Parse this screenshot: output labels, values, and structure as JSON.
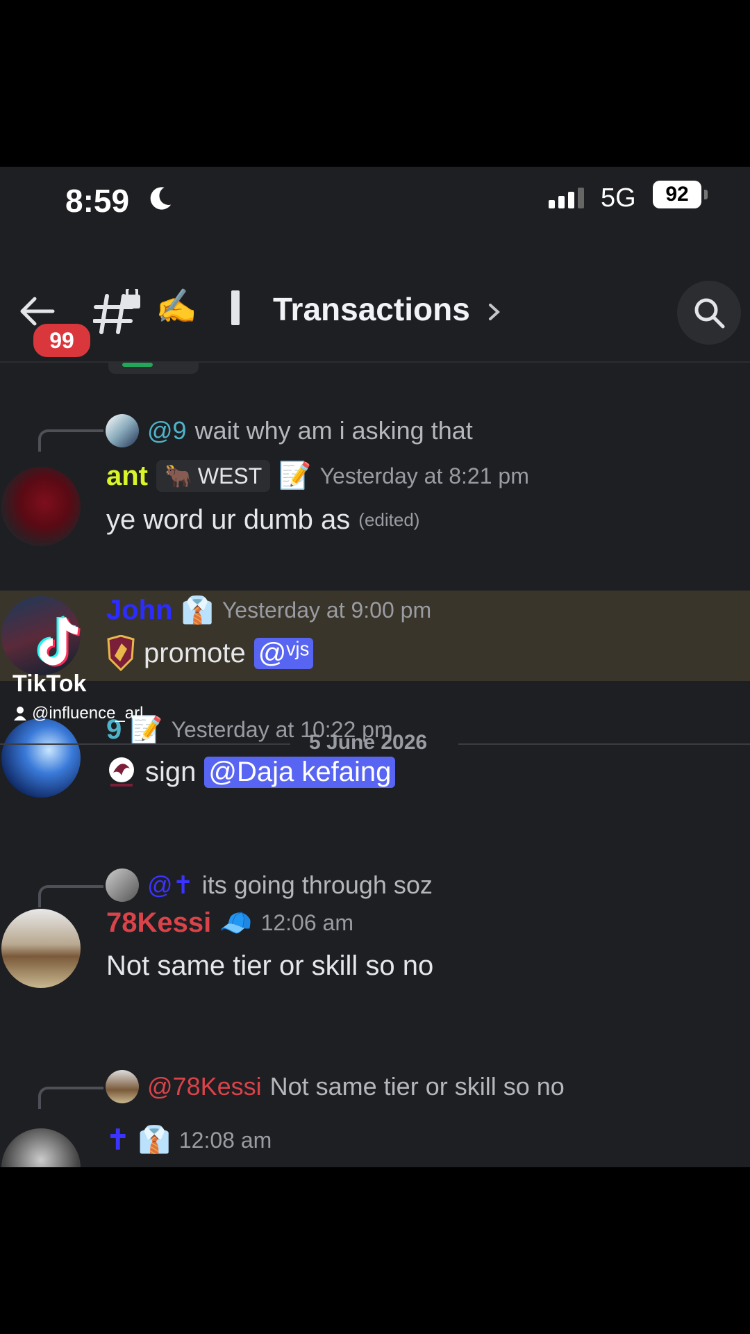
{
  "status_bar": {
    "time": "8:59",
    "network": "5G",
    "battery": "92"
  },
  "header": {
    "unread_count": "99",
    "channel_name": "Transactions"
  },
  "messages": [
    {
      "reply_to": {
        "author": "@9",
        "text": "wait why am i asking that"
      },
      "author": "ant",
      "role": "WEST",
      "timestamp": "Yesterday at 8:21 pm",
      "text": "ye word ur dumb as",
      "edited": "(edited)"
    },
    {
      "author": "John",
      "timestamp": "Yesterday at 9:00 pm",
      "text": "promote",
      "mention": "@ᵛʲˢ",
      "highlighted": true
    },
    {
      "author": "9",
      "timestamp": "Yesterday at 10:22 pm",
      "text": "sign",
      "mention": "@Daja kefaing"
    },
    {
      "reply_to": {
        "author": "@✝",
        "text": "its going through soz"
      },
      "author": "78Kessi",
      "timestamp": "12:06 am",
      "text": "Not same tier or skill so no"
    },
    {
      "reply_to": {
        "author": "@78Kessi",
        "text": "Not same tier or skill so no"
      },
      "author": "✝",
      "timestamp": "12:08 am"
    }
  ],
  "date_divider": "5 June 2026",
  "watermark": {
    "brand": "TikTok",
    "user": "@influence_arl"
  },
  "colors": {
    "ant": "#d9f52a",
    "john": "#2d2cff",
    "nine": "#4fb3c9",
    "kessi": "#d9434a",
    "cross": "#3b33ff"
  }
}
